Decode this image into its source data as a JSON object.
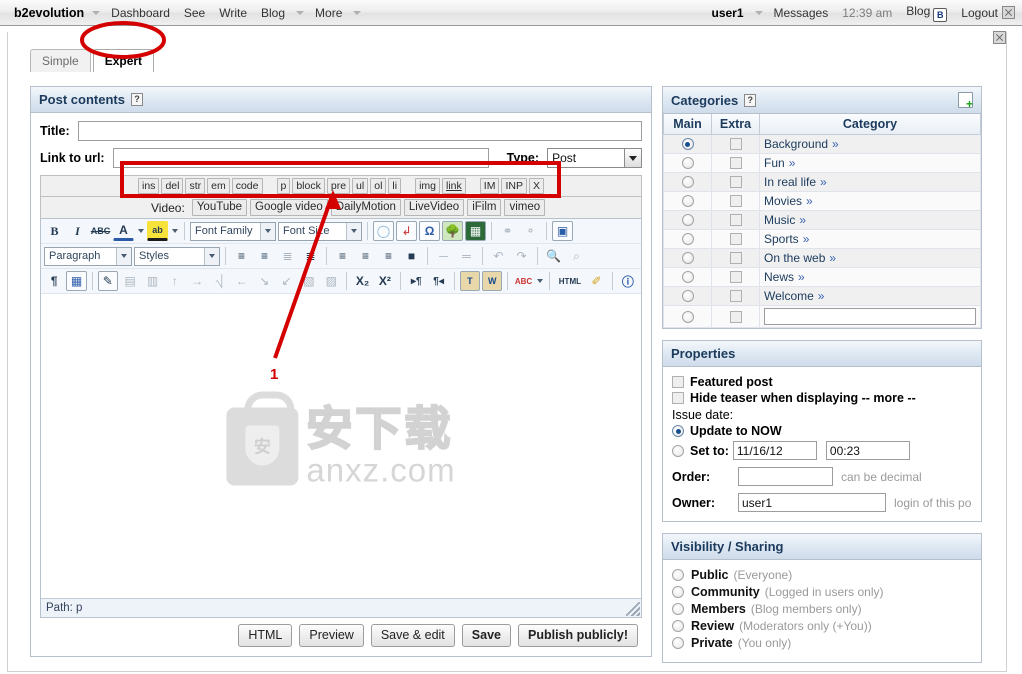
{
  "evobar": {
    "brand": "b2evolution",
    "nav": [
      {
        "label": "Dashboard",
        "caret": false
      },
      {
        "label": "See",
        "caret": false
      },
      {
        "label": "Write",
        "caret": false
      },
      {
        "label": "Blog",
        "caret": true
      },
      {
        "label": "More",
        "caret": true
      }
    ],
    "user": "user1",
    "messages": "Messages",
    "time": "12:39 am",
    "blog": "Blog",
    "blog_badge": "B",
    "logout": "Logout"
  },
  "tabs": [
    {
      "label": "Simple",
      "active": false
    },
    {
      "label": "Expert",
      "active": true
    }
  ],
  "post_contents": {
    "title": "Post contents",
    "help_glyph": "?",
    "title_label": "Title:",
    "title_value": "",
    "link_label": "Link to url:",
    "link_value": "",
    "type_label": "Type:",
    "type_value": "Post",
    "type_options": [
      "Post"
    ],
    "quicktags": [
      "ins",
      "del",
      "str",
      "em",
      "code",
      "p",
      "block",
      "pre",
      "ul",
      "ol",
      "li",
      "img",
      "link",
      "IM",
      "INP",
      "X"
    ],
    "video_label": "Video:",
    "video_buttons": [
      "YouTube",
      "Google video",
      "DailyMotion",
      "LiveVideo",
      "iFilm",
      "vimeo"
    ],
    "editor": {
      "row1": [
        {
          "icon": "bold-icon",
          "glyph": "B",
          "style": "bold"
        },
        {
          "icon": "italic-icon",
          "glyph": "I",
          "style": "italic"
        },
        {
          "icon": "strikethrough-icon",
          "glyph": "ABC",
          "style": "strike"
        },
        {
          "icon": "text-color-icon",
          "glyph": "A",
          "style": "color"
        },
        {
          "icon": "background-color-icon",
          "glyph": "ab",
          "style": "hilite"
        }
      ],
      "font_family": "Font Family",
      "font_size": "Font Size",
      "row1b": [
        {
          "icon": "eraser-icon",
          "glyph": "◯"
        },
        {
          "icon": "nonbreaking-icon",
          "glyph": "⤧"
        },
        {
          "icon": "special-character-icon",
          "glyph": "Ω"
        },
        {
          "icon": "insert-image-icon",
          "glyph": "Ὓc"
        },
        {
          "icon": "insert-media-icon",
          "glyph": "▓"
        },
        {
          "icon": "insert-link-icon",
          "glyph": "⚭"
        },
        {
          "icon": "unlink-icon",
          "glyph": "⚬"
        },
        {
          "icon": "fullscreen-icon",
          "glyph": "▣"
        }
      ],
      "paragraph": "Paragraph",
      "styles": "Styles",
      "row2": [
        {
          "icon": "bullet-list-icon",
          "glyph": "☰"
        },
        {
          "icon": "numbered-list-icon",
          "glyph": "☰"
        },
        {
          "icon": "outdent-icon",
          "glyph": "≡"
        },
        {
          "icon": "indent-icon",
          "glyph": "≡"
        },
        {
          "icon": "align-left-icon",
          "glyph": "≡"
        },
        {
          "icon": "align-center-icon",
          "glyph": "≡"
        },
        {
          "icon": "align-right-icon",
          "glyph": "≡"
        },
        {
          "icon": "align-justify-icon",
          "glyph": "≡"
        },
        {
          "icon": "horizontal-rule-icon",
          "glyph": "─"
        },
        {
          "icon": "page-break-icon",
          "glyph": "═"
        },
        {
          "icon": "undo-icon",
          "glyph": "↶"
        },
        {
          "icon": "redo-icon",
          "glyph": "↷"
        },
        {
          "icon": "find-icon",
          "glyph": "🔍"
        },
        {
          "icon": "find-replace-icon",
          "glyph": "⌕"
        }
      ],
      "row3": [
        {
          "icon": "show-invisibles-icon",
          "glyph": "¶"
        },
        {
          "icon": "table-icon",
          "glyph": "▦"
        },
        {
          "icon": "table-properties-icon",
          "glyph": "✎"
        },
        {
          "icon": "row-properties-icon",
          "glyph": "▤"
        },
        {
          "icon": "cell-properties-icon",
          "glyph": "▥"
        },
        {
          "icon": "insert-row-before-icon",
          "glyph": "↑"
        },
        {
          "icon": "insert-row-after-icon",
          "glyph": "↓"
        },
        {
          "icon": "delete-row-icon",
          "glyph": "✗"
        },
        {
          "icon": "insert-column-before-icon",
          "glyph": "←"
        },
        {
          "icon": "insert-column-after-icon",
          "glyph": "→"
        },
        {
          "icon": "delete-column-icon",
          "glyph": "✖"
        },
        {
          "icon": "split-cells-icon",
          "glyph": "▧"
        },
        {
          "icon": "merge-cells-icon",
          "glyph": "▨"
        },
        {
          "icon": "subscript-icon",
          "glyph": "X₂"
        },
        {
          "icon": "superscript-icon",
          "glyph": "X²"
        },
        {
          "icon": "ltr-icon",
          "glyph": "¶▸"
        },
        {
          "icon": "rtl-icon",
          "glyph": "◂¶"
        },
        {
          "icon": "paste-as-text-icon",
          "glyph": "T"
        },
        {
          "icon": "paste-from-word-icon",
          "glyph": "W"
        },
        {
          "icon": "spellcheck-icon",
          "glyph": "ABC"
        },
        {
          "icon": "edit-html-icon",
          "glyph": "HTML"
        },
        {
          "icon": "cleanup-icon",
          "glyph": "✐"
        },
        {
          "icon": "help-icon",
          "glyph": "?"
        }
      ],
      "body_text": "",
      "status_path": "Path: p",
      "watermark_cn": "安下载",
      "watermark_en": "anxz.com",
      "watermark_badge": "安"
    },
    "buttons": [
      {
        "label": "HTML",
        "strong": false
      },
      {
        "label": "Preview",
        "strong": false
      },
      {
        "label": "Save & edit",
        "strong": false
      },
      {
        "label": "Save",
        "strong": true
      },
      {
        "label": "Publish publicly!",
        "strong": true
      }
    ]
  },
  "categories": {
    "title": "Categories",
    "help_glyph": "?",
    "columns": [
      "Main",
      "Extra",
      "Category"
    ],
    "rows": [
      {
        "name": "Background",
        "indent": 0,
        "main": true,
        "extra": false,
        "chev": "»"
      },
      {
        "name": "Fun",
        "indent": 0,
        "main": false,
        "extra": false,
        "chev": "»"
      },
      {
        "name": "In real life",
        "indent": 1,
        "main": false,
        "extra": false,
        "chev": "»"
      },
      {
        "name": "Movies",
        "indent": 2,
        "main": false,
        "extra": false,
        "chev": "»"
      },
      {
        "name": "Music",
        "indent": 2,
        "main": false,
        "extra": false,
        "chev": "»"
      },
      {
        "name": "Sports",
        "indent": 2,
        "main": false,
        "extra": false,
        "chev": "»"
      },
      {
        "name": "On the web",
        "indent": 1,
        "main": false,
        "extra": false,
        "chev": "»"
      },
      {
        "name": "News",
        "indent": 0,
        "main": false,
        "extra": false,
        "chev": "»"
      },
      {
        "name": "Welcome",
        "indent": 0,
        "main": false,
        "extra": false,
        "chev": "»"
      }
    ],
    "new_category_value": ""
  },
  "properties": {
    "title": "Properties",
    "featured_label": "Featured post",
    "featured_checked": false,
    "hide_teaser_label": "Hide teaser when displaying -- more --",
    "hide_teaser_checked": false,
    "issue_date_label": "Issue date:",
    "update_now_label": "Update to NOW",
    "update_now_selected": true,
    "set_to_label": "Set to:",
    "set_to_selected": false,
    "date_value": "11/16/12",
    "time_value": "00:23",
    "order_label": "Order:",
    "order_value": "",
    "order_hint": "can be decimal",
    "owner_label": "Owner:",
    "owner_value": "user1",
    "owner_hint": "login of this po"
  },
  "visibility": {
    "title": "Visibility / Sharing",
    "options": [
      {
        "name": "Public",
        "desc": "(Everyone)",
        "selected": false
      },
      {
        "name": "Community",
        "desc": "(Logged in users only)",
        "selected": false
      },
      {
        "name": "Members",
        "desc": "(Blog members only)",
        "selected": false
      },
      {
        "name": "Review",
        "desc": "(Moderators only (+You))",
        "selected": false
      },
      {
        "name": "Private",
        "desc": "(You only)",
        "selected": false
      }
    ]
  },
  "annotations": {
    "marker_1": "1",
    "color": "#d40000"
  }
}
